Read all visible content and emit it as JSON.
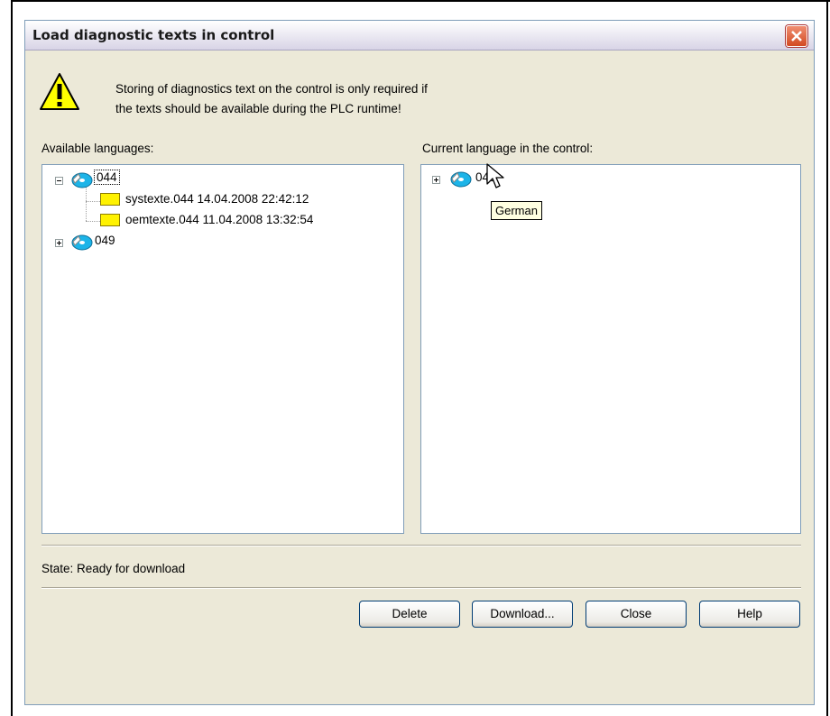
{
  "dialog": {
    "title": "Load diagnostic texts in control",
    "warning_line1": "Storing of diagnostics text on the control is only required if",
    "warning_line2": "the texts should be available during the PLC runtime!"
  },
  "available": {
    "label": "Available languages:",
    "tree": [
      {
        "label": "044",
        "expanded": true,
        "children": [
          {
            "label": "systexte.044 14.04.2008 22:42:12"
          },
          {
            "label": "oemtexte.044 11.04.2008 13:32:54"
          }
        ]
      },
      {
        "label": "049",
        "expanded": false
      }
    ]
  },
  "current": {
    "label": "Current language in the control:",
    "tree": [
      {
        "label": "049",
        "expanded": false
      }
    ],
    "tooltip": "German"
  },
  "status": {
    "text": "State: Ready for download"
  },
  "buttons": {
    "delete": "Delete",
    "download": "Download...",
    "close": "Close",
    "help": "Help"
  },
  "icons": {
    "warning": "warning-icon",
    "language": "language-disk-icon",
    "folder": "folder-icon",
    "close": "close-icon",
    "cursor": "mouse-cursor-icon"
  },
  "colors": {
    "dialog_bg": "#ece9d8",
    "close_button": "#d24a22",
    "folder": "#fff200",
    "tooltip_bg": "#ffffe1"
  }
}
